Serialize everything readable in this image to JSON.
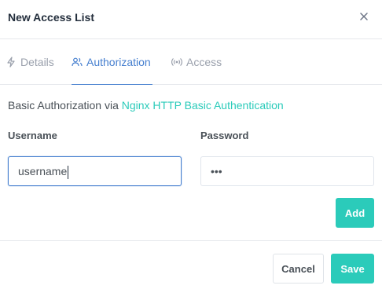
{
  "modal": {
    "title": "New Access List"
  },
  "tabs": [
    {
      "label": "Details",
      "icon": "lightning-icon",
      "active": false
    },
    {
      "label": "Authorization",
      "icon": "users-icon",
      "active": true
    },
    {
      "label": "Access",
      "icon": "broadcast-icon",
      "active": false
    }
  ],
  "authorization": {
    "description_prefix": "Basic Authorization via ",
    "description_link": "Nginx HTTP Basic Authentication",
    "username_label": "Username",
    "password_label": "Password",
    "username_value": "username",
    "password_value": "•••",
    "add_label": "Add"
  },
  "footer": {
    "cancel_label": "Cancel",
    "save_label": "Save"
  },
  "colors": {
    "primary": "#467fcf",
    "teal": "#2bcbba",
    "muted": "#9aa0ac"
  }
}
